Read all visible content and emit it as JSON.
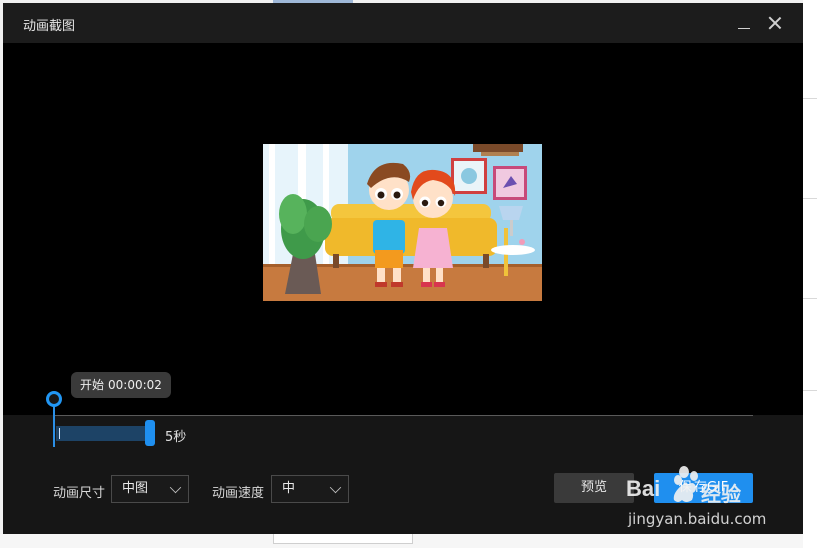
{
  "window": {
    "title": "动画截图"
  },
  "timeline": {
    "tooltip_label": "开始",
    "tooltip_time": "00:00:02",
    "duration_label": "5秒"
  },
  "controls": {
    "size_label": "动画尺寸",
    "size_value": "中图",
    "speed_label": "动画速度",
    "speed_value": "中",
    "preview_button": "预览",
    "save_button_prefix": "保",
    "save_button_text": "存GIF"
  },
  "watermark": {
    "brand": "Bai",
    "word": "经验",
    "url": "jingyan.baidu.com"
  },
  "colors": {
    "accent": "#1f8fef",
    "dialog_bg": "#161616",
    "preview_bg": "#000000"
  }
}
